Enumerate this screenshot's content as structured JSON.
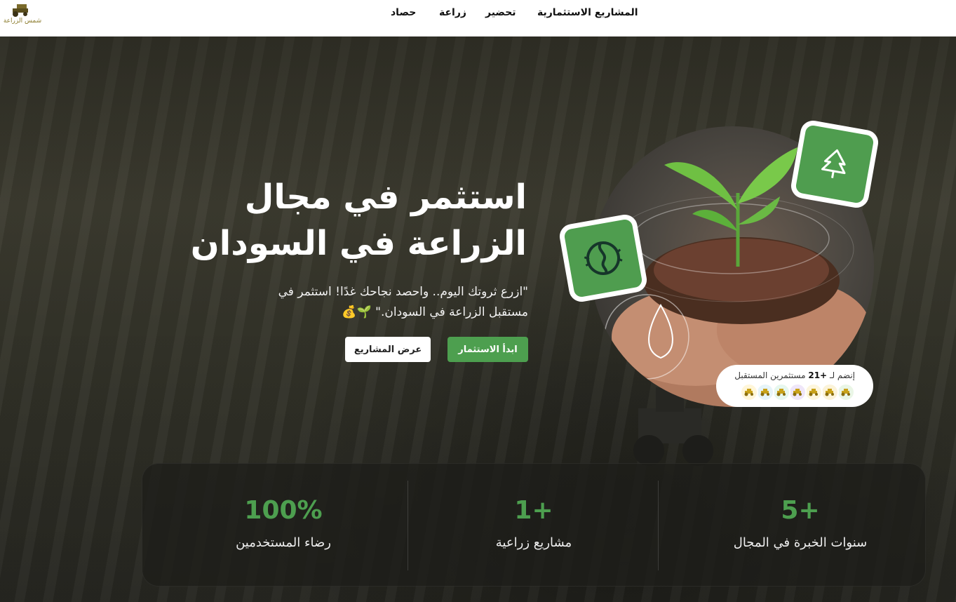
{
  "header": {
    "logo_text": "شمس الزراعة",
    "nav": [
      "المشاريع الاستثمارية",
      "تحضير",
      "زراعة",
      "حصاد"
    ]
  },
  "hero": {
    "title_line1": "استثمر في مجال",
    "title_line2": "الزراعة في السودان",
    "subtitle_line1": "\"ازرع ثروتك اليوم.. واحصد نجاحك غدًا! استثمر في",
    "subtitle_line2": "مستقبل الزراعة في السودان.\" 🌱💰",
    "primary_button": "ابدأ الاستثمار",
    "secondary_button": "عرض المشاريع",
    "investors_prefix": "إنضم لـ",
    "investors_count": "+21",
    "investors_suffix": "مستثمرين المستقبل",
    "avatar_colors": [
      "#fff6d9",
      "#e6f4f9",
      "#e7f7ee",
      "#efe6f9",
      "#fdf6dd",
      "#fbf3d9",
      "#eaf6e6"
    ],
    "badge_top_icon": "tree-icon",
    "badge_left_icon": "seed-icon"
  },
  "stats": [
    {
      "value": "5+",
      "label": "سنوات الخبرة في المجال"
    },
    {
      "value": "1+",
      "label": "مشاريع زراعية"
    },
    {
      "value": "100%",
      "label": "رضاء المستخدمين"
    }
  ],
  "colors": {
    "accent": "#4d9f4f",
    "header_bg": "#ffffff",
    "stats_bg": "#1e1e1a"
  }
}
